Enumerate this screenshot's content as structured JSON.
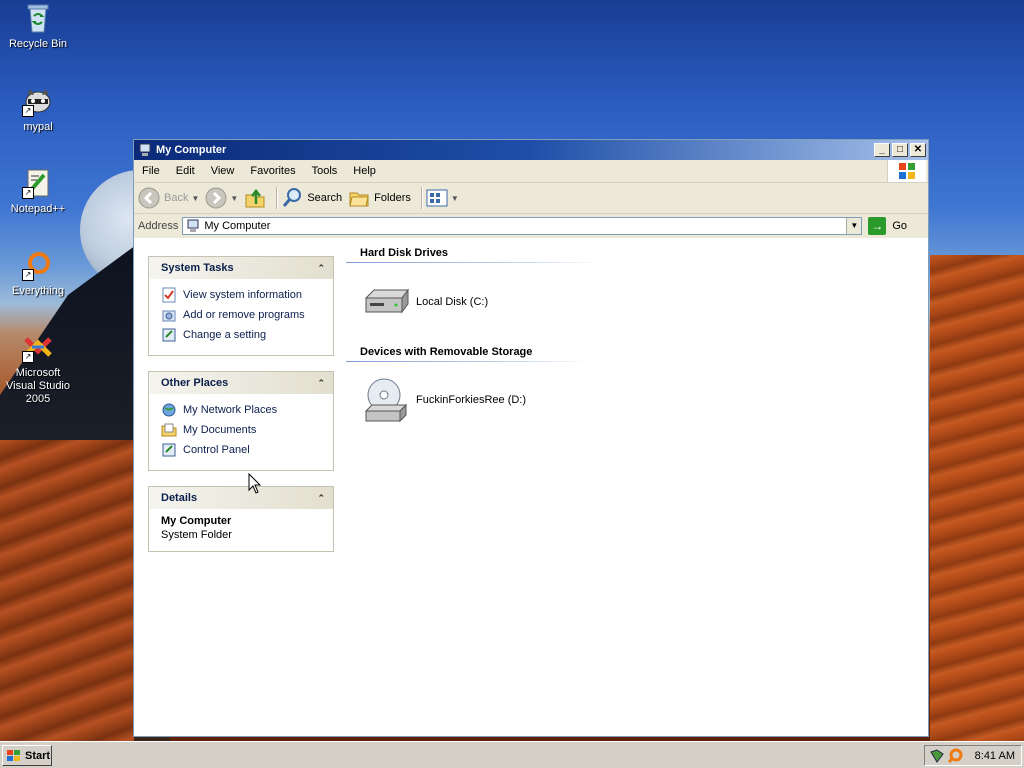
{
  "desktop": {
    "icons": [
      {
        "label": "Recycle Bin",
        "icon": "recycle-bin-icon"
      },
      {
        "label": "mypal",
        "icon": "mypal-raccoon-icon"
      },
      {
        "label": "Notepad++",
        "icon": "notepad-plus-plus-icon"
      },
      {
        "label": "Everything",
        "icon": "everything-search-icon"
      },
      {
        "label": "Microsoft Visual Studio 2005",
        "icon": "visual-studio-icon"
      }
    ]
  },
  "window": {
    "title": "My Computer",
    "menu": [
      "File",
      "Edit",
      "View",
      "Favorites",
      "Tools",
      "Help"
    ],
    "toolbar": {
      "back": "Back",
      "search": "Search",
      "folders": "Folders"
    },
    "address": {
      "label": "Address",
      "value": "My Computer",
      "go": "Go"
    },
    "taskpane": {
      "system_tasks": {
        "title": "System Tasks",
        "items": [
          "View system information",
          "Add or remove programs",
          "Change a setting"
        ]
      },
      "other_places": {
        "title": "Other Places",
        "items": [
          "My Network Places",
          "My Documents",
          "Control Panel"
        ]
      },
      "details": {
        "title": "Details",
        "name": "My Computer",
        "type": "System Folder"
      }
    },
    "groups": [
      {
        "title": "Hard Disk Drives",
        "items": [
          "Local Disk (C:)"
        ]
      },
      {
        "title": "Devices with Removable Storage",
        "items": [
          "FuckinForkiesRee (D:)"
        ]
      }
    ]
  },
  "taskbar": {
    "start": "Start",
    "clock": "8:41 AM"
  }
}
